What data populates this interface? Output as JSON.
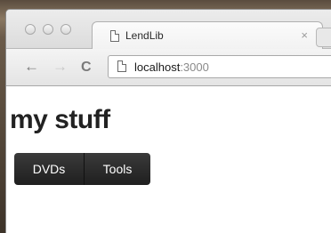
{
  "browser": {
    "tab": {
      "title": "LendLib",
      "close_glyph": "×"
    },
    "nav": {
      "back": "←",
      "forward": "→",
      "reload": "C"
    },
    "address": {
      "host": "localhost",
      "port": ":3000"
    }
  },
  "page": {
    "title": "my stuff",
    "nav_items": [
      {
        "label": "DVDs"
      },
      {
        "label": "Tools"
      }
    ]
  }
}
